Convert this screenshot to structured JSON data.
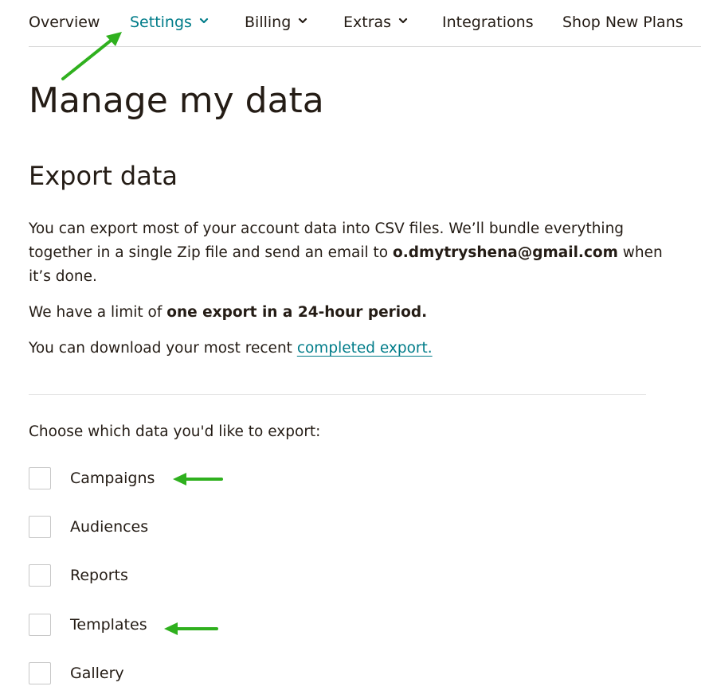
{
  "nav": {
    "items": [
      {
        "label": "Overview",
        "dropdown": false,
        "active": false
      },
      {
        "label": "Settings",
        "dropdown": true,
        "active": true
      },
      {
        "label": "Billing",
        "dropdown": true,
        "active": false
      },
      {
        "label": "Extras",
        "dropdown": true,
        "active": false
      },
      {
        "label": "Integrations",
        "dropdown": false,
        "active": false
      },
      {
        "label": "Shop New Plans",
        "dropdown": false,
        "active": false
      }
    ]
  },
  "page_title": "Manage my data",
  "section_title": "Export data",
  "description": {
    "line1_pre": "You can export most of your account data into CSV files. We’ll bundle everything together in a single Zip file and send an email to ",
    "email": "o.dmytryshena@gmail.com",
    "line1_post": " when it’s done.",
    "limit_pre": "We have a limit of ",
    "limit_bold": "one export in a 24-hour period.",
    "download_pre": "You can download your most recent ",
    "download_link": "completed export."
  },
  "choose_label": "Choose which data you'd like to export:",
  "options": [
    {
      "label": "Campaigns",
      "checked": false
    },
    {
      "label": "Audiences",
      "checked": false
    },
    {
      "label": "Reports",
      "checked": false
    },
    {
      "label": "Templates",
      "checked": false
    },
    {
      "label": "Gallery",
      "checked": false
    }
  ],
  "colors": {
    "accent": "#007c89",
    "text": "#241c15",
    "annotation_arrow": "#2fb01e"
  },
  "icons": {
    "dropdown": "chevron-down-icon",
    "annotation": "green-arrow-icon"
  }
}
